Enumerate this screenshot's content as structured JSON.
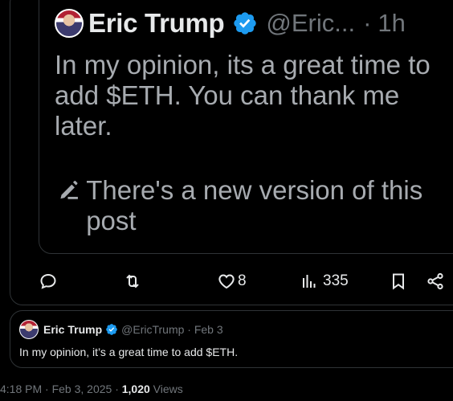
{
  "quote": {
    "name": "Eric Trump",
    "handle": "@Eric...",
    "dot": "·",
    "time": "1h",
    "text": "In my opinion, its a great time to add $ETH. You can thank me later.",
    "new_version": "There's a new version of this post"
  },
  "actions": {
    "likes": "8",
    "views": "335"
  },
  "tweet": {
    "name": "Eric Trump",
    "meta": "@EricTrump · Feb 3",
    "text": "In my opinion, it’s a great time to add $ETH."
  },
  "footer": {
    "datetime": "4:18 PM · Feb 3, 2025 · ",
    "views_count": "1,020",
    "views_label": " Views"
  },
  "colors": {
    "background": "#000000",
    "text": "#e7e9ea",
    "muted": "#71767b",
    "verified": "#1d9bf0",
    "border": "#2f3336"
  }
}
